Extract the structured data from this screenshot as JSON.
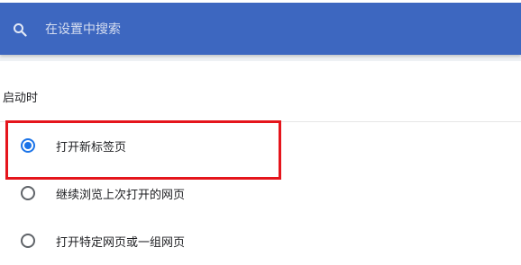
{
  "search": {
    "placeholder": "在设置中搜索",
    "icon": "search-icon"
  },
  "startup": {
    "title": "启动时",
    "options": [
      {
        "label": "打开新标签页",
        "selected": true
      },
      {
        "label": "继续浏览上次打开的网页",
        "selected": false
      },
      {
        "label": "打开特定网页或一组网页",
        "selected": false
      }
    ]
  },
  "colors": {
    "header": "#3d67c0",
    "accent": "#1a73e8",
    "highlight": "#e5151c"
  }
}
